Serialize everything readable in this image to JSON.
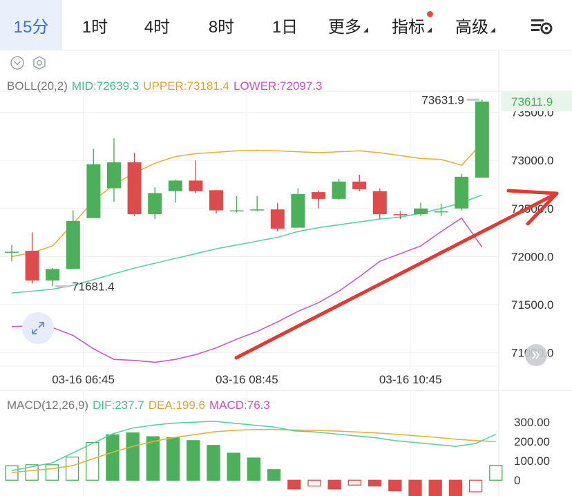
{
  "tabs": [
    {
      "label": "15分",
      "active": true
    },
    {
      "label": "1时"
    },
    {
      "label": "4时"
    },
    {
      "label": "8时"
    },
    {
      "label": "1日"
    },
    {
      "label": "更多"
    },
    {
      "label": "指标"
    },
    {
      "label": "高级"
    }
  ],
  "colors": {
    "up": "#4caf5a",
    "down": "#de4b4b",
    "mid": "#5ecfa5",
    "upper": "#e3b33a",
    "lower": "#c85bc9",
    "accent": "#2f6fe4",
    "arrow": "#e23a30"
  },
  "chart_data": [
    {
      "type": "candlestick",
      "legend": {
        "boll": "BOLL(20,2)",
        "mid": "MID:72639.3",
        "upper": "UPPER:73181.4",
        "lower": "LOWER:72097.3"
      },
      "y_axis_ticks": [
        "73500.0",
        "73000.0",
        "72500.0",
        "72000.0",
        "71500.0",
        "71000.0"
      ],
      "y_axis_values": [
        73500,
        73000,
        72500,
        72000,
        71500,
        71000
      ],
      "ylim": [
        70860,
        73720
      ],
      "x_tick_labels": [
        "03-16 06:45",
        "03-16 08:45",
        "03-16 10:45"
      ],
      "x_tick_index": [
        3,
        11,
        19
      ],
      "last_price": "73611.9",
      "max_label": "73631.9",
      "min_label": "71681.4",
      "candles": [
        {
          "o": 72050,
          "h": 72120,
          "l": 71950,
          "c": 72050
        },
        {
          "o": 72060,
          "h": 72250,
          "l": 71720,
          "c": 71750
        },
        {
          "o": 71750,
          "h": 71880,
          "l": 71690,
          "c": 71870
        },
        {
          "o": 71870,
          "h": 72480,
          "l": 71870,
          "c": 72370
        },
        {
          "o": 72400,
          "h": 73120,
          "l": 72400,
          "c": 72960
        },
        {
          "o": 72710,
          "h": 73230,
          "l": 72570,
          "c": 72980
        },
        {
          "o": 72980,
          "h": 73080,
          "l": 72420,
          "c": 72440
        },
        {
          "o": 72440,
          "h": 72720,
          "l": 72390,
          "c": 72660
        },
        {
          "o": 72680,
          "h": 72800,
          "l": 72560,
          "c": 72790
        },
        {
          "o": 72790,
          "h": 73000,
          "l": 72660,
          "c": 72680
        },
        {
          "o": 72690,
          "h": 72690,
          "l": 72450,
          "c": 72480
        },
        {
          "o": 72480,
          "h": 72630,
          "l": 72460,
          "c": 72480
        },
        {
          "o": 72490,
          "h": 72630,
          "l": 72470,
          "c": 72490
        },
        {
          "o": 72490,
          "h": 72560,
          "l": 72260,
          "c": 72290
        },
        {
          "o": 72300,
          "h": 72710,
          "l": 72300,
          "c": 72650
        },
        {
          "o": 72670,
          "h": 72690,
          "l": 72500,
          "c": 72600
        },
        {
          "o": 72600,
          "h": 72810,
          "l": 72590,
          "c": 72780
        },
        {
          "o": 72780,
          "h": 72850,
          "l": 72680,
          "c": 72700
        },
        {
          "o": 72680,
          "h": 72710,
          "l": 72390,
          "c": 72440
        },
        {
          "o": 72440,
          "h": 72470,
          "l": 72390,
          "c": 72430
        },
        {
          "o": 72440,
          "h": 72560,
          "l": 72420,
          "c": 72500
        },
        {
          "o": 72460,
          "h": 72550,
          "l": 72420,
          "c": 72470
        },
        {
          "o": 72500,
          "h": 72860,
          "l": 72480,
          "c": 72830
        },
        {
          "o": 72820,
          "h": 73631.9,
          "l": 72820,
          "c": 73611.9
        }
      ],
      "mid_line": [
        71620,
        71640,
        71660,
        71700,
        71760,
        71820,
        71880,
        71930,
        71980,
        72030,
        72080,
        72120,
        72160,
        72200,
        72260,
        72300,
        72330,
        72360,
        72390,
        72410,
        72450,
        72500,
        72560,
        72639.3
      ],
      "upper_line": [
        72000,
        72040,
        72110,
        72340,
        72580,
        72750,
        72870,
        72970,
        73040,
        73070,
        73085,
        73100,
        73105,
        73100,
        73090,
        73080,
        73090,
        73100,
        73080,
        73050,
        73020,
        73010,
        72950,
        73181.4
      ],
      "lower_line": [
        71270,
        71280,
        71260,
        71180,
        71040,
        70930,
        70920,
        70900,
        70930,
        70980,
        71050,
        71140,
        71220,
        71320,
        71430,
        71520,
        71640,
        71790,
        71950,
        72030,
        72110,
        72260,
        72400,
        72097.3
      ]
    },
    {
      "type": "bar",
      "legend": {
        "macd": "MACD(12,26,9)",
        "dif": "DIF:237.7",
        "dea": "DEA:199.6",
        "hist": "MACD:76.3"
      },
      "y_axis_ticks": [
        "300.00",
        "200.00",
        "100.00",
        "0"
      ],
      "y_axis_values": [
        300,
        200,
        100,
        0
      ],
      "ylim": [
        -60,
        340
      ],
      "histogram": [
        75,
        80,
        80,
        120,
        195,
        235,
        245,
        225,
        220,
        205,
        180,
        140,
        115,
        55,
        -45,
        -30,
        -45,
        -25,
        -30,
        -55,
        -90,
        -95,
        -90,
        -60,
        76.3
      ],
      "dif": [
        50,
        70,
        90,
        140,
        190,
        240,
        270,
        285,
        295,
        300,
        305,
        295,
        285,
        275,
        255,
        250,
        240,
        230,
        220,
        205,
        195,
        185,
        175,
        190,
        237.7
      ],
      "dea": [
        40,
        50,
        60,
        75,
        110,
        145,
        175,
        200,
        220,
        235,
        250,
        258,
        262,
        262,
        260,
        258,
        255,
        250,
        245,
        238,
        230,
        222,
        212,
        205,
        199.6
      ]
    }
  ]
}
